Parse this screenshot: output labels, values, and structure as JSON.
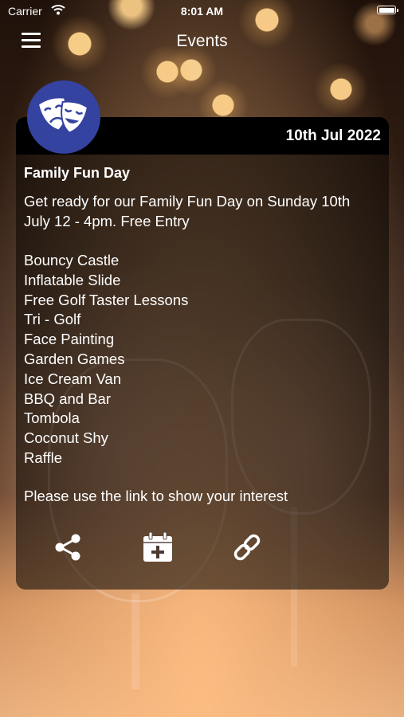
{
  "status_bar": {
    "carrier": "Carrier",
    "time": "8:01 AM",
    "icons": [
      "wifi-icon",
      "battery-icon"
    ]
  },
  "nav": {
    "title": "Events",
    "menu_icon": "hamburger-menu-icon"
  },
  "event": {
    "avatar_icon": "theater-masks-icon",
    "date": "10th Jul 2022",
    "title": "Family Fun Day",
    "intro": "Get ready for our Family Fun Day on Sunday 10th July 12 - 4pm. Free Entry",
    "activities": [
      "Bouncy Castle",
      "Inflatable Slide",
      "Free Golf Taster Lessons",
      "Tri - Golf",
      "Face Painting",
      "Garden Games",
      "Ice Cream Van",
      "BBQ and Bar",
      "Tombola",
      "Coconut Shy",
      "Raffle"
    ],
    "cta": "Please use the link to show your interest",
    "actions": [
      "share-icon",
      "calendar-add-icon",
      "link-icon"
    ]
  },
  "colors": {
    "avatar_bg": "#3442a0",
    "text": "#ffffff",
    "card_header": "#000000"
  }
}
